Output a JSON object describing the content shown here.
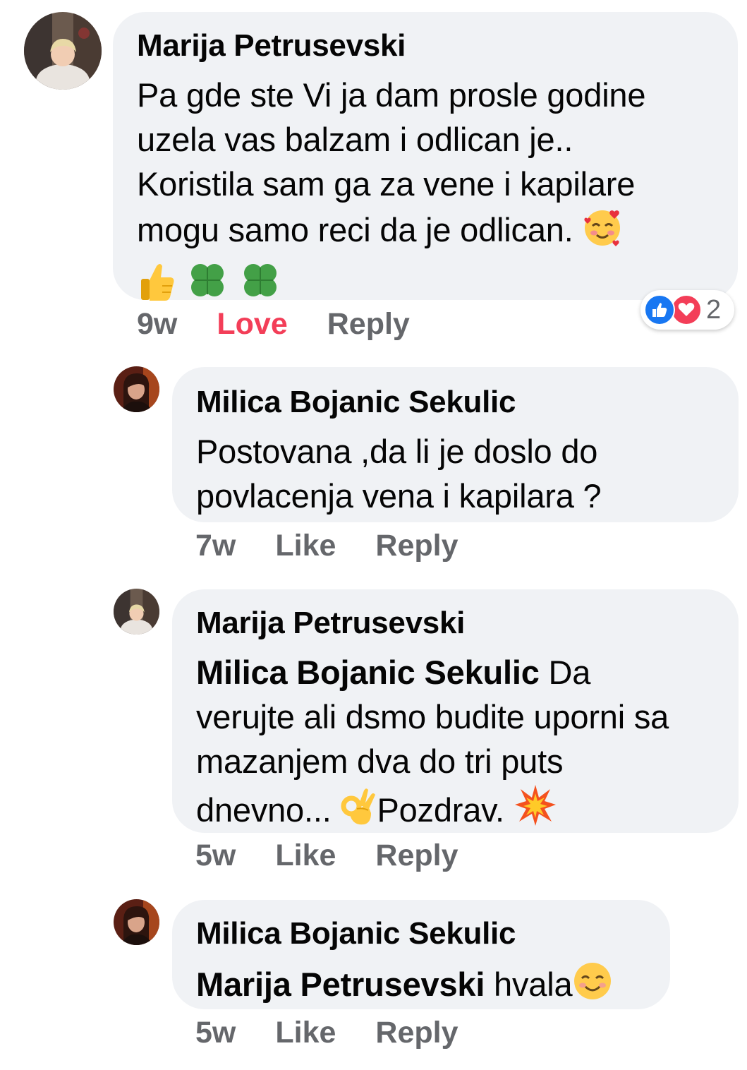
{
  "comments": [
    {
      "author": "Marija Petrusevski",
      "text_lines": [
        "Pa  gde ste Vi ja dam prosle godine",
        "uzela vas balzam i odlican je..",
        "Koristila sam ga za vene i kapilare",
        "mogu samo reci da je odlican. "
      ],
      "emojis": [
        "smiling-face-with-hearts",
        "thumbs-up",
        "four-leaf-clover",
        "four-leaf-clover"
      ],
      "time": "9w",
      "reaction_label": "Love",
      "reply_label": "Reply",
      "reactions": {
        "types": [
          "like",
          "love"
        ],
        "count": "2"
      }
    },
    {
      "author": "Milica Bojanic Sekulic",
      "text_lines": [
        "Postovana ,da li je doslo do",
        "povlacenja vena i kapilara ?"
      ],
      "time": "7w",
      "reaction_label": "Like",
      "reply_label": "Reply"
    },
    {
      "author": "Marija Petrusevski",
      "mention": "Milica Bojanic Sekulic",
      "text_first": " Da",
      "text_lines": [
        "verujte ali dsmo budite uporni sa",
        "mazanjem dva do tri puts"
      ],
      "text_last_a": "dnevno... ",
      "text_last_b": "Pozdrav. ",
      "emojis": [
        "ok-hand",
        "collision"
      ],
      "time": "5w",
      "reaction_label": "Like",
      "reply_label": "Reply"
    },
    {
      "author": "Milica Bojanic Sekulic",
      "mention": "Marija Petrusevski",
      "text": " hvala",
      "emojis": [
        "smiling-face-with-smiling-eyes"
      ],
      "time": "5w",
      "reaction_label": "Like",
      "reply_label": "Reply"
    }
  ],
  "colors": {
    "bubble": "#f0f2f5",
    "meta": "#65676b",
    "love": "#f33e58",
    "like": "#1877f2"
  }
}
